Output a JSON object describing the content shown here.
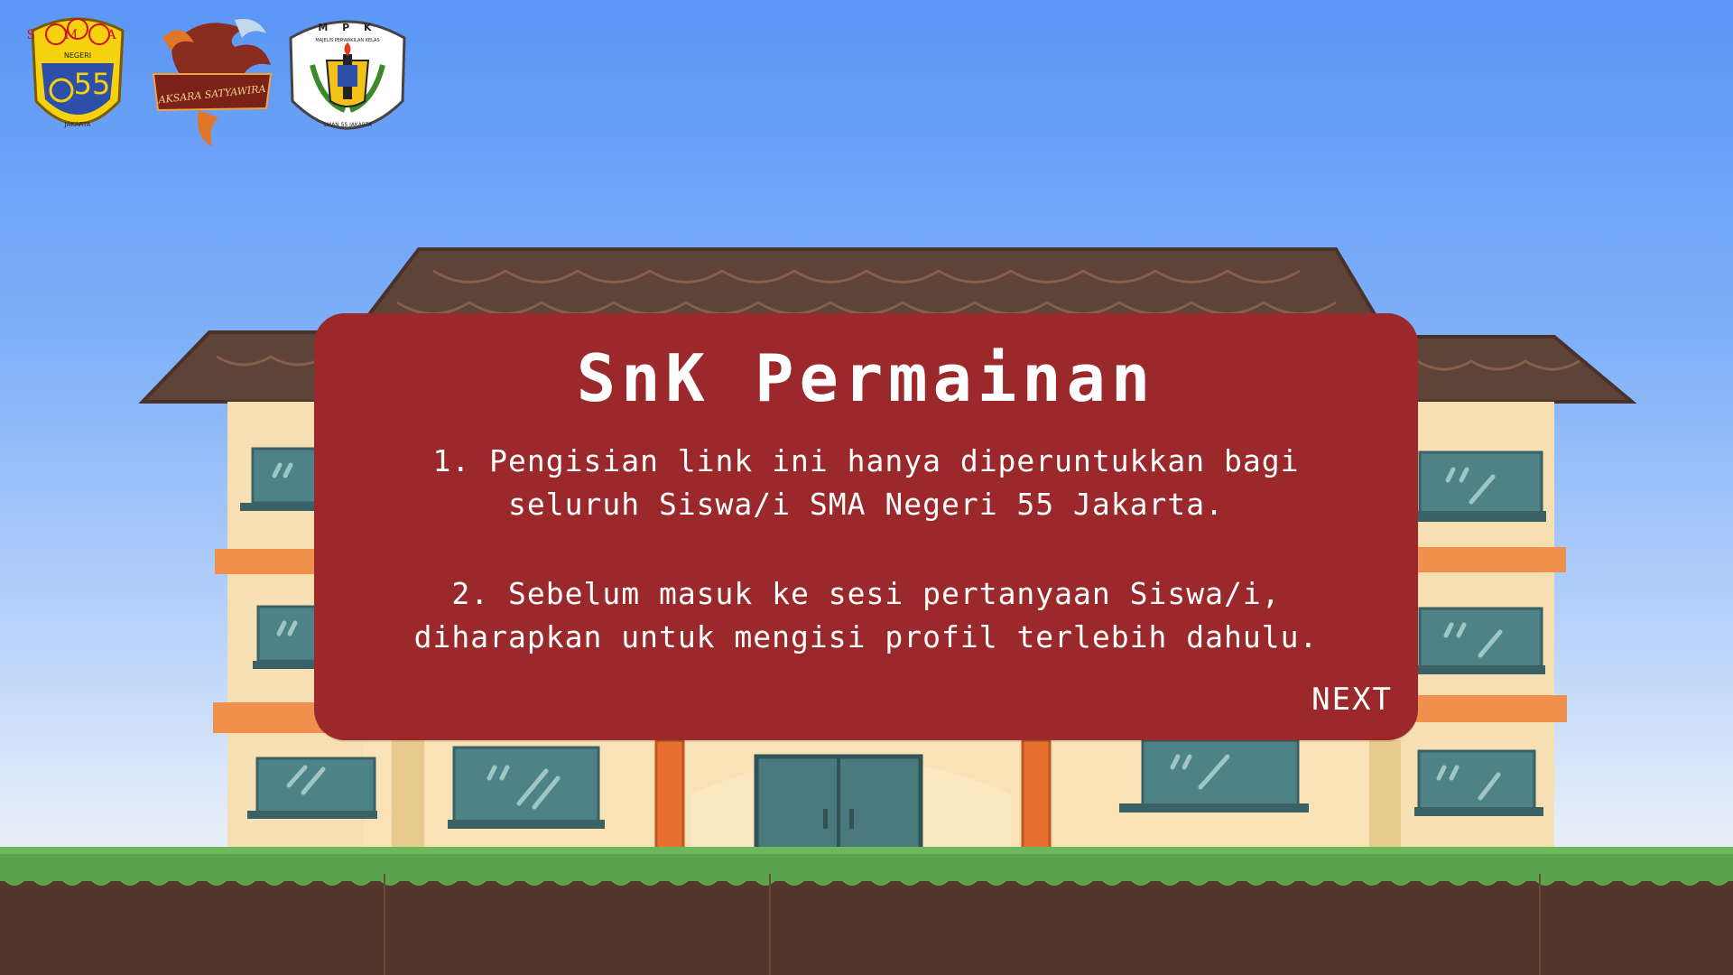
{
  "logos": [
    {
      "name": "sma-negeri-55-logo",
      "text_top": "S M A",
      "text_mid": "NEGERI",
      "number": "55",
      "text_bottom": "JAKARTA"
    },
    {
      "name": "aksara-satyawira-logo",
      "text": "AKSARA SATYAWIRA"
    },
    {
      "name": "mpk-logo",
      "text_top": "M P K",
      "subtitle": "MAJELIS PERWAKILAN KELAS",
      "text_bottom": "SMAN 55 JAKARTA"
    }
  ],
  "dialog": {
    "title": "SnK Permainan",
    "rule1_line1": "1. Pengisian link ini hanya diperuntukkan bagi",
    "rule1_line2": "seluruh Siswa/i SMA Negeri 55 Jakarta.",
    "rule2_line1": "2. Sebelum masuk ke sesi pertanyaan Siswa/i,",
    "rule2_line2": "diharapkan untuk mengisi profil terlebih dahulu.",
    "next_label": "NEXT"
  },
  "colors": {
    "sky_top": "#5b96f6",
    "dialog_bg": "#9b292b",
    "roof": "#5e4338",
    "wall": "#f6dfb2",
    "ledge": "#f0904c",
    "window": "#4d8286",
    "grass": "#5aa54c",
    "soil": "#54372a"
  }
}
